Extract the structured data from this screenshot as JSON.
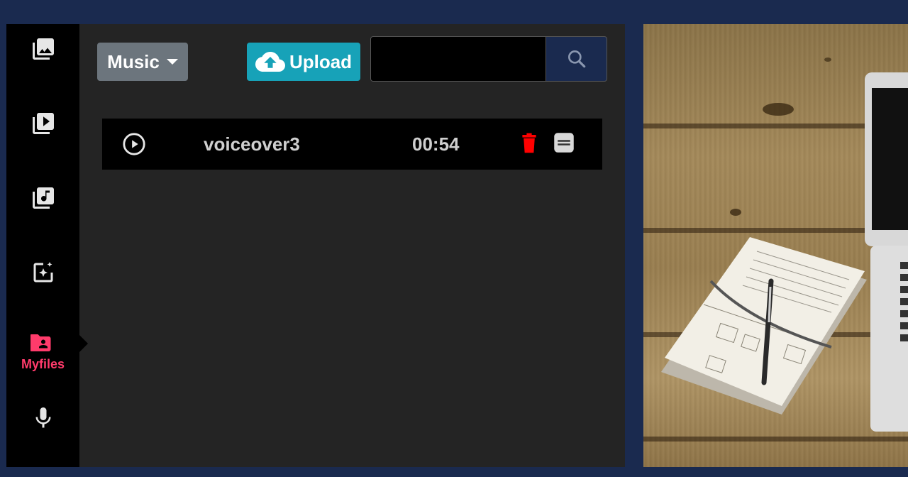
{
  "sidebar": {
    "items": [
      {
        "id": "images",
        "icon": "image-library-icon",
        "label": ""
      },
      {
        "id": "videos",
        "icon": "video-library-icon",
        "label": ""
      },
      {
        "id": "music",
        "icon": "music-library-icon",
        "label": ""
      },
      {
        "id": "effects",
        "icon": "sparkle-image-icon",
        "label": ""
      },
      {
        "id": "myfiles",
        "icon": "folder-user-icon",
        "label": "Myfiles",
        "active": true
      },
      {
        "id": "voice",
        "icon": "microphone-icon",
        "label": ""
      }
    ],
    "active_color": "#ff3b6b"
  },
  "toolbar": {
    "category_label": "Music",
    "upload_label": "Upload",
    "search_value": "",
    "search_placeholder": ""
  },
  "files": [
    {
      "name": "voiceover3",
      "duration": "00:54"
    }
  ],
  "colors": {
    "background": "#1a2a4f",
    "panel": "#242424",
    "rail": "#000000",
    "upload": "#17a2b8",
    "category": "#6c757d",
    "delete": "#ff0000"
  }
}
